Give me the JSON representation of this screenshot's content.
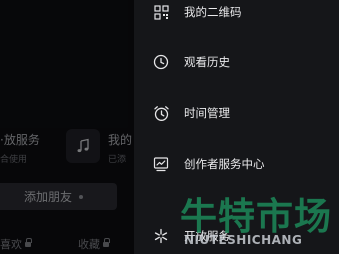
{
  "background_page": {
    "service_label": "·放服务",
    "service_sub": "合使用",
    "music_icon": "music-note-icon",
    "mine_label": "我的",
    "mine_sub": "已添",
    "add_friend_label": "添加朋友",
    "tab_like_label": "喜欢",
    "tab_favorite_label": "收藏"
  },
  "drawer": {
    "items": [
      {
        "label": "我的二维码",
        "icon": "qr-code-icon"
      },
      {
        "label": "观看历史",
        "icon": "clock-icon"
      },
      {
        "label": "时间管理",
        "icon": "alarm-clock-icon"
      },
      {
        "label": "创作者服务中心",
        "icon": "creator-chart-icon"
      },
      {
        "label": "开放服务",
        "icon": "sparkle-icon"
      }
    ]
  },
  "watermark": {
    "chinese": "牛特市场",
    "english": "NIUTESHICHANG"
  },
  "colors": {
    "drawer_bg": "#151619",
    "page_bg": "#0b0c0f",
    "watermark_green": "#1c8054"
  }
}
